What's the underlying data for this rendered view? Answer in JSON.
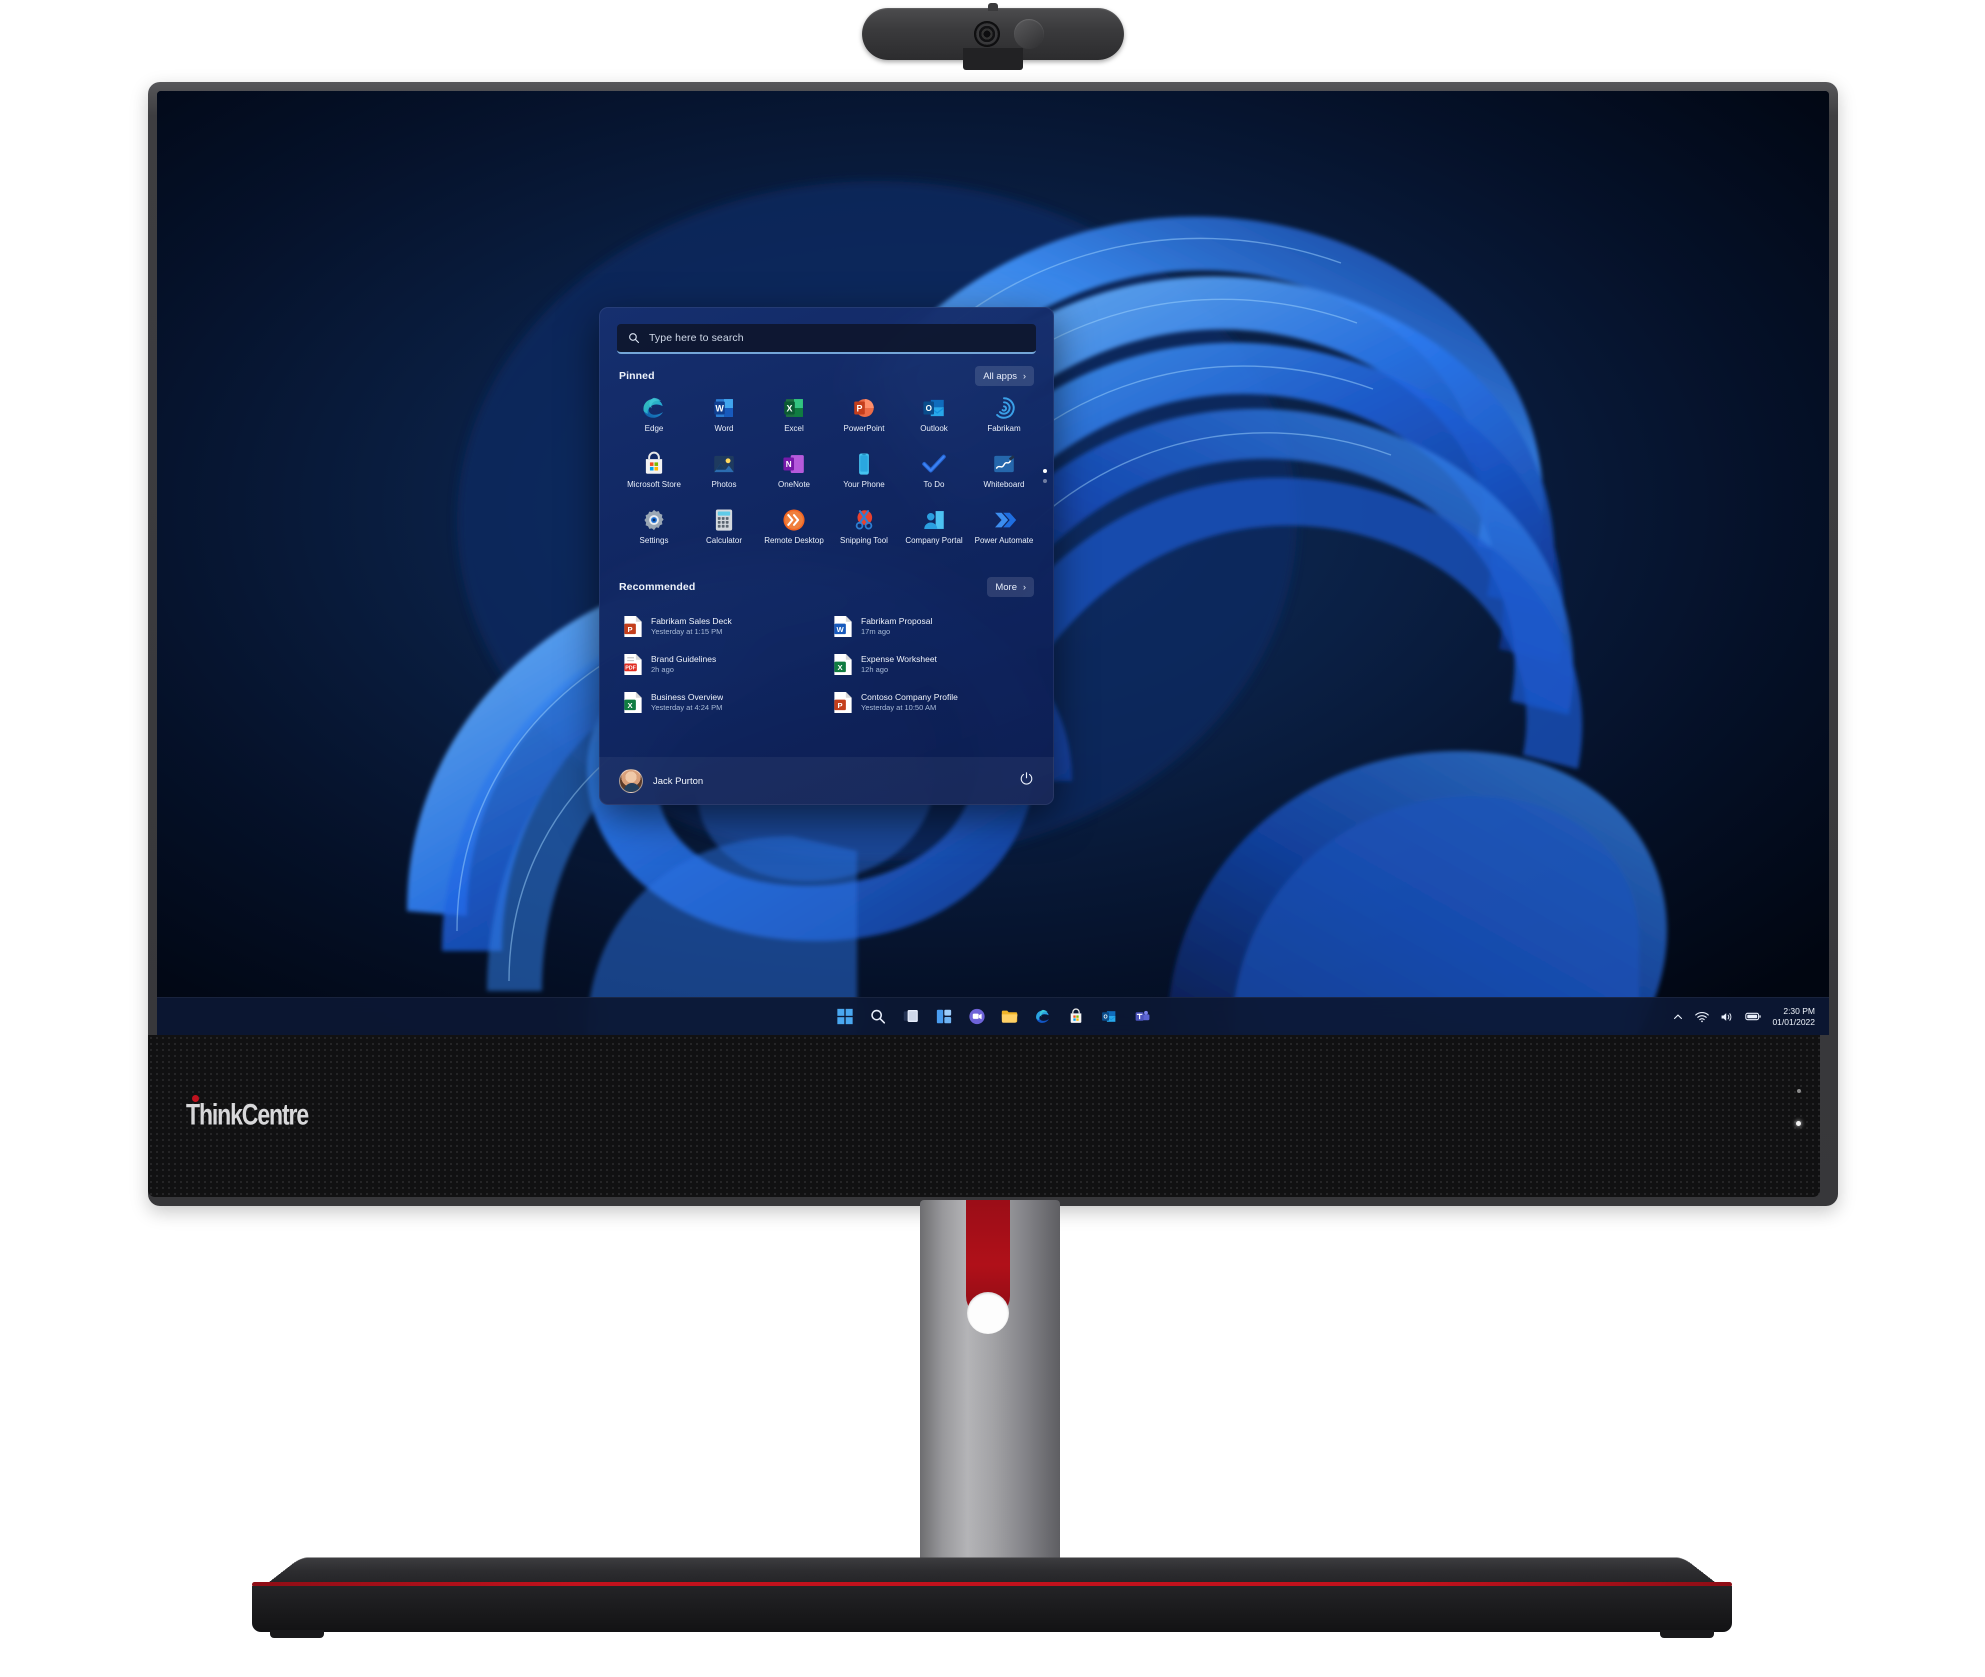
{
  "device": {
    "brand_logo": "ThinkCentre",
    "webcam": {
      "lens": "camera-lens",
      "shutter": "privacy-shutter-cover"
    },
    "accent_red": "#c2121d",
    "bezel_color": "#3e3e41"
  },
  "desktop": {
    "wallpaper": "Windows 11 Bloom",
    "background_color": "#04102a"
  },
  "start_menu": {
    "search": {
      "placeholder": "Type here to search",
      "value": "",
      "icon": "search-icon"
    },
    "pinned": {
      "heading": "Pinned",
      "all_apps_label": "All apps",
      "all_apps_chevron": "›",
      "apps": [
        {
          "label": "Edge",
          "icon": "edge-icon"
        },
        {
          "label": "Word",
          "icon": "word-icon"
        },
        {
          "label": "Excel",
          "icon": "excel-icon"
        },
        {
          "label": "PowerPoint",
          "icon": "powerpoint-icon"
        },
        {
          "label": "Outlook",
          "icon": "outlook-icon"
        },
        {
          "label": "Fabrikam",
          "icon": "fabrikam-icon"
        },
        {
          "label": "Microsoft Store",
          "icon": "microsoft-store-icon"
        },
        {
          "label": "Photos",
          "icon": "photos-icon"
        },
        {
          "label": "OneNote",
          "icon": "onenote-icon"
        },
        {
          "label": "Your Phone",
          "icon": "your-phone-icon"
        },
        {
          "label": "To Do",
          "icon": "to-do-icon"
        },
        {
          "label": "Whiteboard",
          "icon": "whiteboard-icon"
        },
        {
          "label": "Settings",
          "icon": "settings-icon"
        },
        {
          "label": "Calculator",
          "icon": "calculator-icon"
        },
        {
          "label": "Remote Desktop",
          "icon": "remote-desktop-icon"
        },
        {
          "label": "Snipping Tool",
          "icon": "snipping-tool-icon"
        },
        {
          "label": "Company Portal",
          "icon": "company-portal-icon"
        },
        {
          "label": "Power Automate",
          "icon": "power-automate-icon"
        }
      ],
      "page_dots": 2,
      "active_page": 1
    },
    "recommended": {
      "heading": "Recommended",
      "more_label": "More",
      "more_chevron": "›",
      "items": [
        {
          "name": "Fabrikam Sales Deck",
          "time": "Yesterday at 1:15 PM",
          "icon": "powerpoint-file-icon"
        },
        {
          "name": "Fabrikam Proposal",
          "time": "17m ago",
          "icon": "word-file-icon"
        },
        {
          "name": "Brand Guidelines",
          "time": "2h ago",
          "icon": "pdf-file-icon"
        },
        {
          "name": "Expense Worksheet",
          "time": "12h ago",
          "icon": "excel-file-icon"
        },
        {
          "name": "Business Overview",
          "time": "Yesterday at 4:24 PM",
          "icon": "excel-file-icon"
        },
        {
          "name": "Contoso Company Profile",
          "time": "Yesterday at 10:50 AM",
          "icon": "powerpoint-file-icon"
        }
      ]
    },
    "user": {
      "name": "Jack Purton",
      "avatar": "user-avatar",
      "power_icon": "power-icon"
    }
  },
  "taskbar": {
    "items": [
      {
        "name": "start-button",
        "icon": "windows-logo-icon"
      },
      {
        "name": "search-button",
        "icon": "search-icon"
      },
      {
        "name": "task-view-button",
        "icon": "task-view-icon"
      },
      {
        "name": "widgets-button",
        "icon": "widgets-icon"
      },
      {
        "name": "chat-button",
        "icon": "chat-icon"
      },
      {
        "name": "file-explorer-button",
        "icon": "file-explorer-icon"
      },
      {
        "name": "edge-button",
        "icon": "edge-icon"
      },
      {
        "name": "store-button",
        "icon": "microsoft-store-icon"
      },
      {
        "name": "outlook-button",
        "icon": "outlook-icon"
      },
      {
        "name": "teams-button",
        "icon": "teams-icon"
      }
    ],
    "tray": {
      "show_hidden_icon": "chevron-up-icon",
      "network_icon": "wifi-icon",
      "volume_icon": "speaker-icon",
      "battery_icon": "battery-icon",
      "time": "2:30 PM",
      "date": "01/01/2022"
    }
  }
}
